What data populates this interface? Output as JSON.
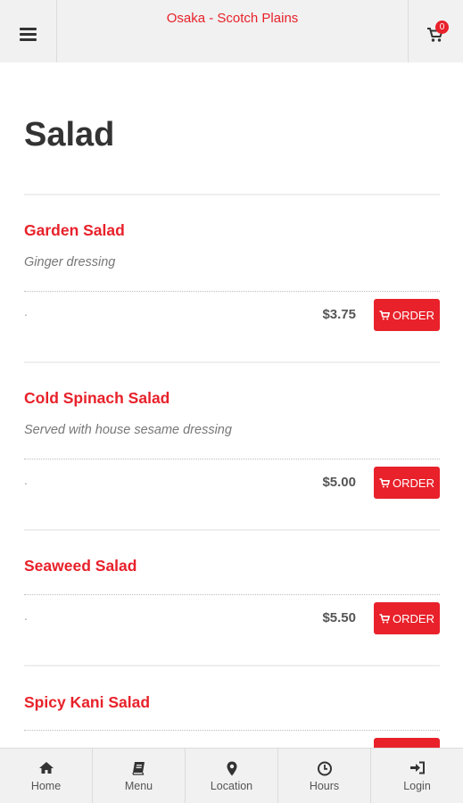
{
  "header": {
    "title": "Osaka - Scotch Plains",
    "menu_icon": "hamburger-icon",
    "cart_icon": "cart-icon",
    "cart_count": "0"
  },
  "section": {
    "title": "Salad"
  },
  "items": [
    {
      "name": "Garden Salad",
      "description": "Ginger dressing",
      "dot": ".",
      "price": "$3.75",
      "order_label": "ORDER"
    },
    {
      "name": "Cold Spinach Salad",
      "description": "Served with house sesame dressing",
      "dot": ".",
      "price": "$5.00",
      "order_label": "ORDER"
    },
    {
      "name": "Seaweed Salad",
      "description": "",
      "dot": ".",
      "price": "$5.50",
      "order_label": "ORDER"
    },
    {
      "name": "Spicy Kani Salad",
      "description": "",
      "dot": "",
      "price": "",
      "order_label": ""
    }
  ],
  "bottom_nav": [
    {
      "label": "Home",
      "icon": "home-icon"
    },
    {
      "label": "Menu",
      "icon": "book-icon"
    },
    {
      "label": "Location",
      "icon": "map-marker-icon"
    },
    {
      "label": "Hours",
      "icon": "clock-icon"
    },
    {
      "label": "Login",
      "icon": "sign-in-icon"
    }
  ],
  "colors": {
    "accent": "#e8212a",
    "bar_background": "#f1f1f1",
    "text_dark": "#333333"
  }
}
